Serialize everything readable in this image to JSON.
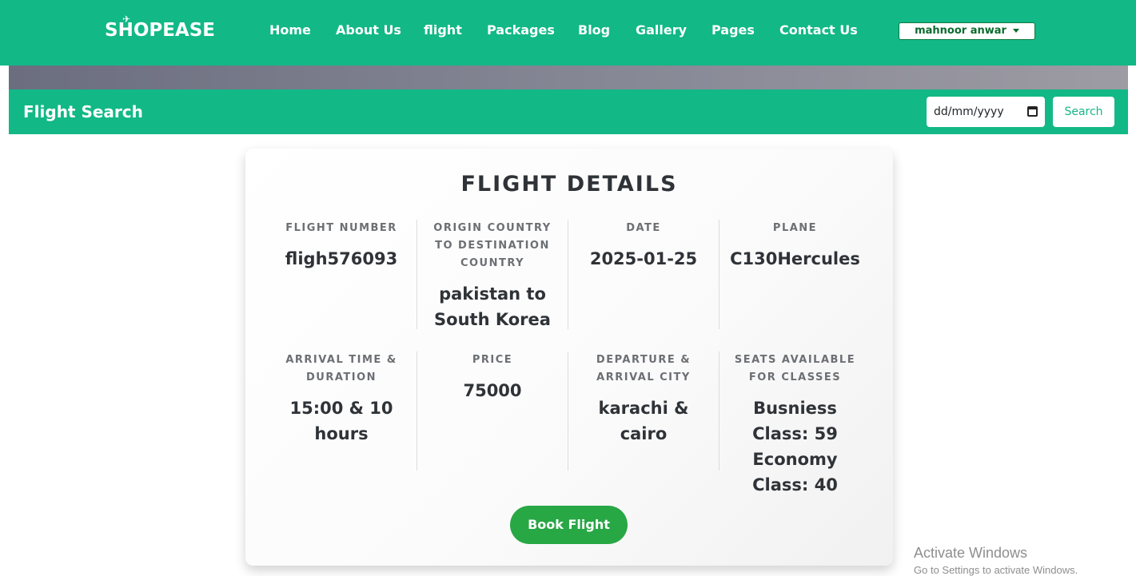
{
  "navbar": {
    "brand": "SHOPEASE",
    "items": [
      "Home",
      "About Us",
      "flight",
      "Packages",
      "Blog",
      "Gallery",
      "Pages",
      "Contact Us"
    ],
    "user": "mahnoor anwar"
  },
  "search": {
    "title": "Flight Search",
    "date_placeholder": "dd/mm/yyyy",
    "button": "Search"
  },
  "details": {
    "title": "FLIGHT DETAILS",
    "fields": [
      {
        "label": "FLIGHT NUMBER",
        "value": "fligh576093"
      },
      {
        "label": "ORIGIN COUNTRY TO DESTINATION COUNTRY",
        "value": "pakistan to South Korea"
      },
      {
        "label": "DATE",
        "value": "2025-01-25"
      },
      {
        "label": "PLANE",
        "value": "C130Hercules"
      },
      {
        "label": "ARRIVAL TIME & DURATION",
        "value": "15:00 & 10 hours"
      },
      {
        "label": "PRICE",
        "value": "75000"
      },
      {
        "label": "DEPARTURE & ARRIVAL CITY",
        "value": "karachi & cairo"
      },
      {
        "label": "SEATS AVAILABLE FOR CLASSES",
        "value": "Busniess Class: 59 Economy Class: 40"
      }
    ],
    "book_button": "Book Flight"
  },
  "watermark": {
    "line1": "Activate Windows",
    "line2": "Go to Settings to activate Windows."
  },
  "colors": {
    "brand_green": "#12b886",
    "button_green": "#28a745",
    "text_dark": "#2f3338"
  }
}
